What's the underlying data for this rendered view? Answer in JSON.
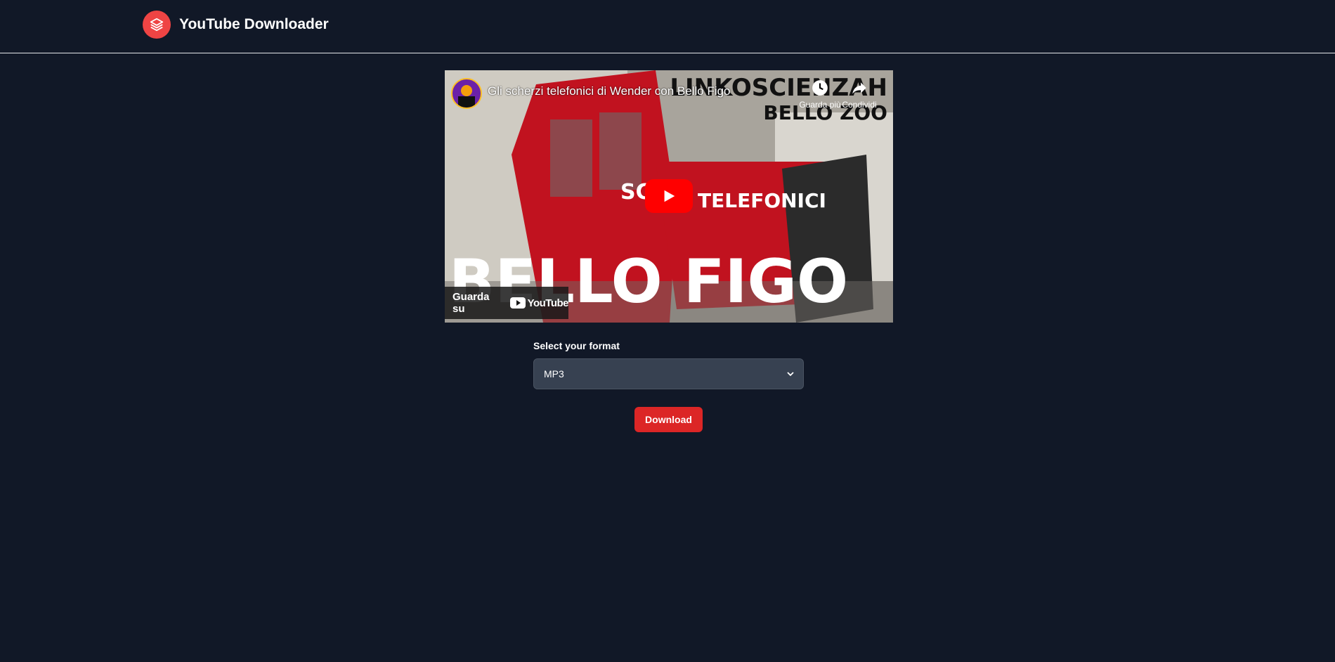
{
  "header": {
    "title": "YouTube Downloader",
    "logo_icon": "layers-icon"
  },
  "video": {
    "title": "Gli scherzi telefonici di Wender con Bello Figo",
    "thumbnail_text": {
      "top": "LINKOSCIENZAH",
      "sub": "BELLO ZOO",
      "middle_left": "SC",
      "middle_right": "TELEFONICI",
      "big": "BELLO FIGO"
    },
    "watch_later_label": "Guarda più",
    "share_label": "Condividi",
    "watch_on_label": "Guarda su",
    "youtube_brand": "YouTube"
  },
  "form": {
    "label": "Select your format",
    "selected": "MP3",
    "options": [
      "MP3"
    ]
  },
  "download_button": "Download",
  "colors": {
    "background": "#111827",
    "accent": "#dc2626",
    "select_bg": "#374151"
  }
}
